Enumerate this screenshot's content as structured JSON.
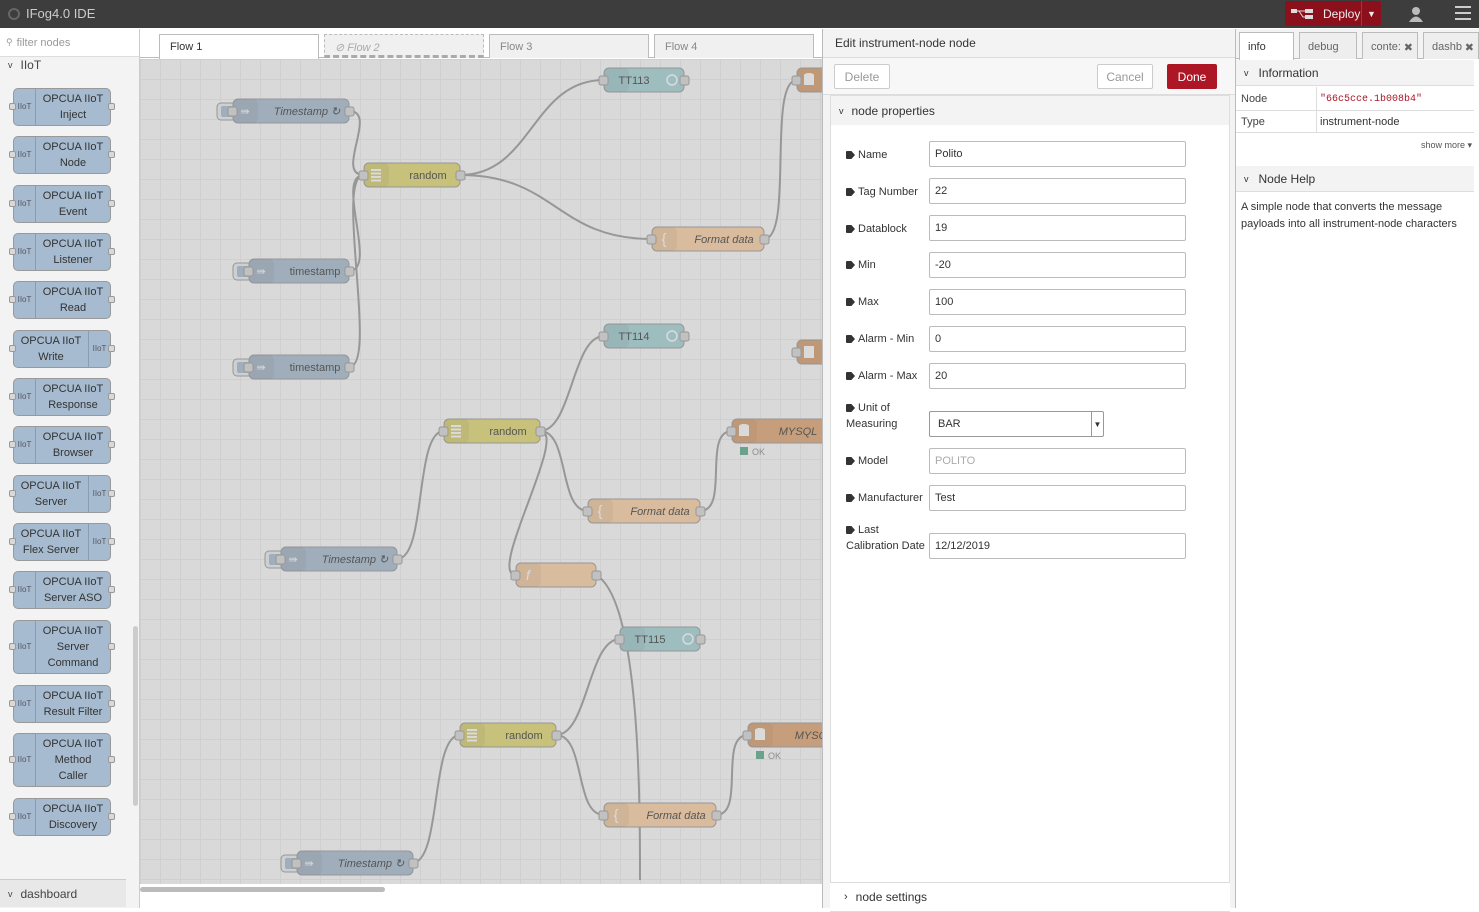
{
  "header": {
    "title": "IFog4.0 IDE",
    "deploy_label": "Deploy"
  },
  "palette": {
    "filter_placeholder": "filter nodes",
    "category": "IIoT",
    "nodes": [
      {
        "l1": "OPCUA IIoT",
        "l2": "Inject"
      },
      {
        "l1": "OPCUA IIoT",
        "l2": "Node"
      },
      {
        "l1": "OPCUA IIoT",
        "l2": "Event"
      },
      {
        "l1": "OPCUA IIoT",
        "l2": "Listener"
      },
      {
        "l1": "OPCUA IIoT",
        "l2": "Read"
      },
      {
        "l1": "OPCUA IIoT",
        "l2": "Write"
      },
      {
        "l1": "OPCUA IIoT",
        "l2": "Response"
      },
      {
        "l1": "OPCUA IIoT",
        "l2": "Browser"
      },
      {
        "l1": "OPCUA IIoT",
        "l2": "Server"
      },
      {
        "l1": "OPCUA IIoT",
        "l2": "Flex Server"
      },
      {
        "l1": "OPCUA IIoT",
        "l2": "Server ASO"
      },
      {
        "l1": "OPCUA IIoT",
        "l2": "Server",
        "l3": "Command"
      },
      {
        "l1": "OPCUA IIoT",
        "l2": "Result Filter"
      },
      {
        "l1": "OPCUA IIoT",
        "l2": "Method",
        "l3": "Caller"
      },
      {
        "l1": "OPCUA IIoT",
        "l2": "Discovery"
      }
    ],
    "category2": "dashboard",
    "node_icon_text": "IIoT"
  },
  "workspace": {
    "tabs": [
      "Flow 1",
      "Flow 2",
      "Flow 3",
      "Flow 4"
    ],
    "flow_nodes": {
      "tt113": "TT113",
      "tt114": "TT114",
      "tt115": "TT115",
      "timestamp1": "Timestamp ↻",
      "timestamp2": "timestamp",
      "timestamp3": "timestamp",
      "timestamp4": "Timestamp ↻",
      "timestamp5": "Timestamp ↻",
      "random1": "random",
      "random2": "random",
      "random3": "random",
      "format1": "Format data",
      "format2": "Format data",
      "format3": "Format data",
      "mysql1": "MYSQL",
      "mysql2": "MYSQL",
      "ok": "OK"
    }
  },
  "editor": {
    "title": "Edit instrument-node node",
    "delete_label": "Delete",
    "cancel_label": "Cancel",
    "done_label": "Done",
    "section_props": "node properties",
    "section_settings": "node settings",
    "fields": {
      "name": {
        "label": "Name",
        "value": "Polito"
      },
      "tag": {
        "label": "Tag Number",
        "value": "22"
      },
      "datablock": {
        "label": "Datablock",
        "value": "19"
      },
      "min": {
        "label": "Min",
        "value": "-20"
      },
      "max": {
        "label": "Max",
        "value": "100"
      },
      "amin": {
        "label": "Alarm - Min",
        "value": "0"
      },
      "amax": {
        "label": "Alarm - Max",
        "value": "20"
      },
      "unit": {
        "label1": "Unit of",
        "label2": "Measuring",
        "value": "BAR"
      },
      "model": {
        "label": "Model",
        "placeholder": "POLITO"
      },
      "manufacturer": {
        "label": "Manufacturer",
        "value": "Test"
      },
      "calib": {
        "label1": "Last",
        "label2": "Calibration Date",
        "value": "12/12/2019"
      }
    }
  },
  "sidebar": {
    "tabs": [
      "info",
      "debug",
      "conte:",
      "dashb"
    ],
    "info_header": "Information",
    "node_key": "Node",
    "node_val": "\"66c5cce.1b008b4\"",
    "type_key": "Type",
    "type_val": "instrument-node",
    "show_more": "show more ▾",
    "help_header": "Node Help",
    "help_text": "A simple node that converts the message payloads into all instrument-node characters"
  }
}
